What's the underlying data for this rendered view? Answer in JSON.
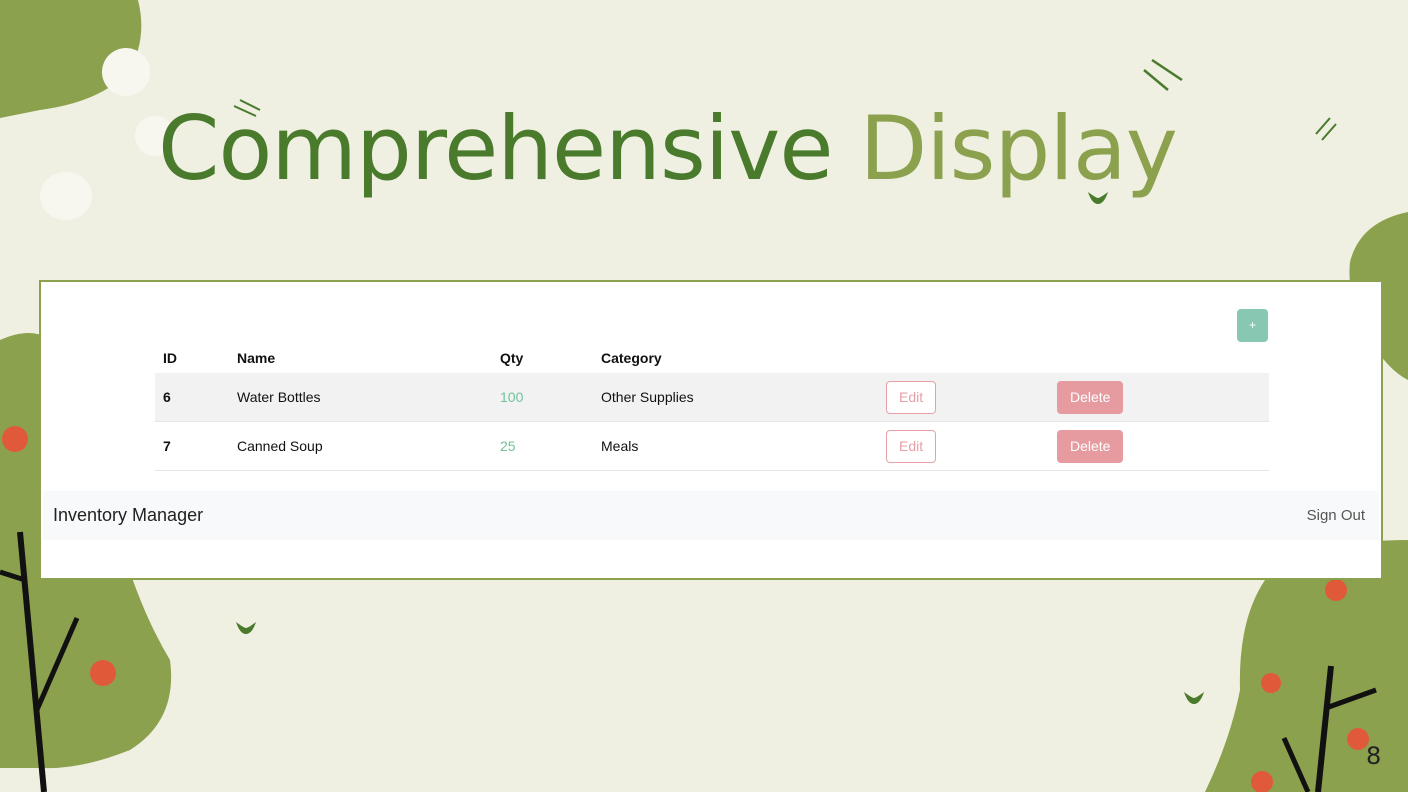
{
  "slide": {
    "title_part1": "Comprehensive",
    "title_part2": "Display",
    "page_number": "8"
  },
  "app": {
    "add_button_label": "+",
    "brand": "Inventory Manager",
    "sign_out_label": "Sign Out"
  },
  "table": {
    "headers": {
      "id": "ID",
      "name": "Name",
      "qty": "Qty",
      "category": "Category"
    },
    "rows": [
      {
        "id": "6",
        "name": "Water Bottles",
        "qty": "100",
        "category": "Other Supplies",
        "edit": "Edit",
        "delete": "Delete"
      },
      {
        "id": "7",
        "name": "Canned Soup",
        "qty": "25",
        "category": "Meals",
        "edit": "Edit",
        "delete": "Delete"
      }
    ]
  },
  "colors": {
    "background": "#eff0e2",
    "title_dark_green": "#4a7a2c",
    "title_light_green": "#8ca14e",
    "panel_border": "#8ca14e",
    "add_button": "#88c8b3",
    "delete_button": "#e59ba0",
    "qty_text": "#6fc49a",
    "berry": "#e05a3a"
  }
}
